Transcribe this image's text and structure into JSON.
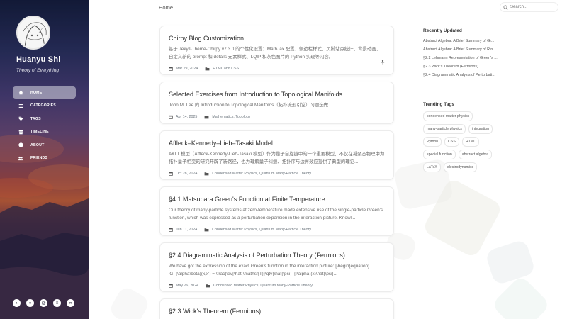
{
  "site": {
    "title": "Huanyu Shi",
    "subtitle": "Theory of Everything"
  },
  "nav": [
    {
      "label": "HOME",
      "icon": "home-icon",
      "active": true
    },
    {
      "label": "CATEGORIES",
      "icon": "stream-icon",
      "active": false
    },
    {
      "label": "TAGS",
      "icon": "tags-icon",
      "active": false
    },
    {
      "label": "TIMELINE",
      "icon": "archive-icon",
      "active": false
    },
    {
      "label": "ABOUT",
      "icon": "info-icon",
      "active": false
    },
    {
      "label": "FRIENDS",
      "icon": "users-icon",
      "active": false
    }
  ],
  "social": [
    "theme-toggle-icon",
    "github-icon",
    "email-icon",
    "rss-icon",
    "link-icon"
  ],
  "topbar": {
    "breadcrumb": "Home",
    "search_placeholder": "Search..."
  },
  "posts": [
    {
      "title": "Chirpy Blog Customization",
      "excerpt": "基于 Jekyll-Theme-Chirpy v7.3.0 的个性化设置：MathJax 配置、侧边栏样式、页脚站点统计、背景动画、自定义新的 prompt 和 details 元素样式、LQIP 和灰色图片的 Python 实现等内容。",
      "date": "Mar 29, 2024",
      "categories": "HTML and CSS",
      "pinned": true
    },
    {
      "title": "Selected Exercises from Introduction to Topological Manifolds",
      "excerpt": "John M. Lee 的 Introduction to Topological Manifolds（拓扑流形引论）习题选做",
      "date": "Apr 14, 2025",
      "categories": "Mathematics, Topology",
      "pinned": false
    },
    {
      "title": "Affleck–Kennedy–Lieb–Tasaki Model",
      "excerpt": "AKLT 模型（Affleck-Kennedy-Lieb-Tasaki 模型）作为量子自旋链中的一个重要模型，不仅在凝聚态物理中为拓扑量子相变的研究开辟了新路径，也为理解量子纠缠、拓扑序与边界效应提供了典型的理论...",
      "date": "Oct 28, 2024",
      "categories": "Condensed Matter Physics, Quantum Many-Particle Theory",
      "pinned": false
    },
    {
      "title": "§4.1 Matsubara Green's Function at Finite Temperature",
      "excerpt": "Our theory of many-particle systems at zero-temperature made extensive use of the single-particle Green's function, which was expressed as a perturbation expansion in the interaction picture. Knowl...",
      "date": "Jun 11, 2024",
      "categories": "Condensed Matter Physics, Quantum Many-Particle Theory",
      "pinned": false
    },
    {
      "title": "§2.4 Diagrammatic Analysis of Perturbation Theory (Fermions)",
      "excerpt": "We have got the expression of the exact Green's function in the interaction picture: [\\begin{equation} iG_{\\alpha\\beta}(x,x') = \\frac{\\ev{\\hat{\\mathsf{T}}\\qty{\\hat{\\psi}_{I\\alpha}(x)\\hat{\\psi}...",
      "date": "May 26, 2024",
      "categories": "Condensed Matter Physics, Quantum Many-Particle Theory",
      "pinned": false
    },
    {
      "title": "§2.3 Wick's Theorem (Fermions)",
      "excerpt": "",
      "date": "",
      "categories": "",
      "pinned": false
    }
  ],
  "panel": {
    "recent_title": "Recently Updated",
    "recent": [
      "Abstract Algebra: A Brief Summary of Gr...",
      "Abstract Algebra: A Brief Summary of Rin...",
      "§2.2 Lehmann Representation of Green's ...",
      "§2.3 Wick's Theorem (Fermions)",
      "§2.4 Diagrammatic Analysis of Perturbati..."
    ],
    "tags_title": "Trending Tags",
    "tags": [
      "condensed matter physics",
      "many-particle physics",
      "integration",
      "Python",
      "CSS",
      "HTML",
      "special function",
      "abstract algebra",
      "LaTeX",
      "electrodynamics"
    ]
  }
}
